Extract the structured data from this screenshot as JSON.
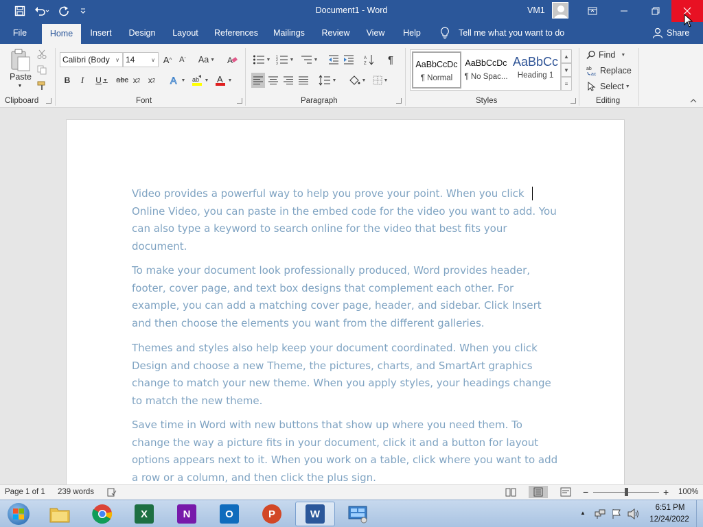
{
  "window": {
    "title": "Document1 - Word",
    "user": "VM1"
  },
  "tabs": [
    "File",
    "Home",
    "Insert",
    "Design",
    "Layout",
    "References",
    "Mailings",
    "Review",
    "View",
    "Help"
  ],
  "tell_me": "Tell me what you want to do",
  "share": "Share",
  "ribbon": {
    "clipboard": {
      "label": "Clipboard",
      "paste": "Paste"
    },
    "font": {
      "label": "Font",
      "font_name": "Calibri (Body",
      "font_size": "14",
      "change_case": "Aa"
    },
    "paragraph": {
      "label": "Paragraph"
    },
    "styles": {
      "label": "Styles",
      "items": [
        {
          "sample": "AaBbCcDc",
          "name": "¶ Normal"
        },
        {
          "sample": "AaBbCcDc",
          "name": "¶ No Spac..."
        },
        {
          "sample": "AaBbCc",
          "name": "Heading 1"
        }
      ]
    },
    "editing": {
      "label": "Editing",
      "find": "Find",
      "replace": "Replace",
      "select": "Select"
    }
  },
  "document": {
    "paragraphs": [
      "Video provides a powerful way to help you prove your point. When you click Online Video, you can paste in the embed code for the video you want to add. You can also type a keyword to search online for the video that best fits your document.",
      "To make your document look professionally produced, Word provides header, footer, cover page, and text box designs that complement each other. For example, you can add a matching cover page, header, and sidebar. Click Insert and then choose the elements you want from the different galleries.",
      "Themes and styles also help keep your document coordinated. When you click Design and choose a new Theme, the pictures, charts, and SmartArt graphics change to match your new theme. When you apply styles, your headings change to match the new theme.",
      "Save time in Word with new buttons that show up where you need them. To change the way a picture fits in your document, click it and a button for layout options appears next to it. When you work on a table, click where you want to add a row or a column, and then click the plus sign."
    ]
  },
  "status": {
    "page": "Page 1 of 1",
    "words": "239 words",
    "zoom": "100%",
    "zoom_fraction": 0.5
  },
  "taskbar": {
    "apps": [
      {
        "name": "file-explorer",
        "letter": ""
      },
      {
        "name": "chrome",
        "letter": ""
      },
      {
        "name": "excel",
        "letter": "X"
      },
      {
        "name": "onenote",
        "letter": "N"
      },
      {
        "name": "outlook",
        "letter": "O"
      },
      {
        "name": "powerpoint",
        "letter": "P"
      },
      {
        "name": "word",
        "letter": "W"
      },
      {
        "name": "control-panel",
        "letter": ""
      }
    ],
    "time": "6:51 PM",
    "date": "12/24/2022"
  },
  "colors": {
    "word_blue": "#2b579a",
    "close_red": "#e81123",
    "doc_text": "#7fa3c2"
  }
}
